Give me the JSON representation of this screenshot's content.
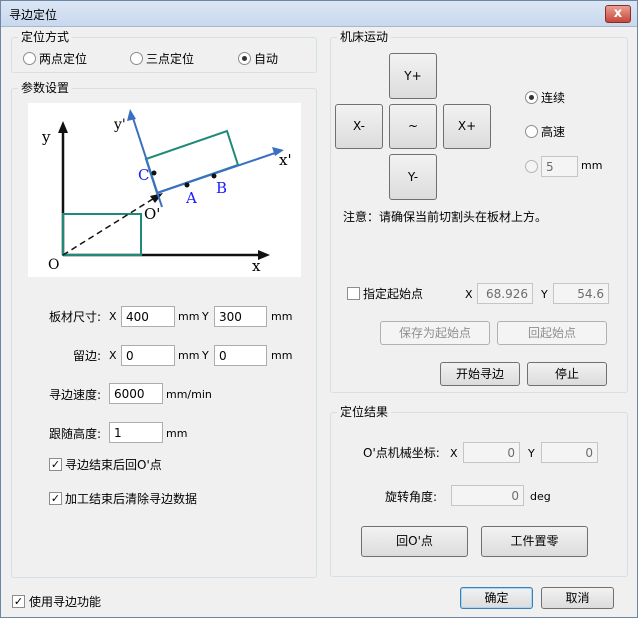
{
  "window": {
    "title": "寻边定位",
    "close": "x"
  },
  "positioning": {
    "title": "定位方式",
    "options": [
      "两点定位",
      "三点定位",
      "自动"
    ],
    "selected": 2
  },
  "params": {
    "title": "参数设置",
    "diagram": {
      "labels": {
        "y_prime": "y'",
        "y": "y",
        "x_prime": "x'",
        "c": "C",
        "a": "A",
        "b": "B",
        "o_prime": "O'",
        "o": "O",
        "x": "x"
      }
    },
    "sheet_size": {
      "label": "板材尺寸:",
      "x_label": "X",
      "x": "400",
      "unit1": "mm",
      "y_label": "Y",
      "y": "300",
      "unit2": "mm"
    },
    "margin": {
      "label": "留边:",
      "x_label": "X",
      "x": "0",
      "unit1": "mm",
      "y_label": "Y",
      "y": "0",
      "unit2": "mm"
    },
    "speed": {
      "label": "寻边速度:",
      "value": "6000",
      "unit": "mm/min"
    },
    "height": {
      "label": "跟随高度:",
      "value": "1",
      "unit": "mm"
    },
    "return_o": {
      "label": "寻边结束后回O'点",
      "checked": true
    },
    "clear_data": {
      "label": "加工结束后清除寻边数据",
      "checked": true
    }
  },
  "machine": {
    "title": "机床运动",
    "jog": {
      "yplus": "Y+",
      "xminus": "X-",
      "center": "~",
      "xplus": "X+",
      "yminus": "Y-"
    },
    "mode": {
      "options": [
        "连续",
        "高速"
      ],
      "selected": 0,
      "step_value": "5",
      "step_unit": "mm"
    },
    "note": "注意：请确保当前切割头在板材上方。",
    "start_point": {
      "label": "指定起始点",
      "checked": false,
      "x_label": "X",
      "x": "68.926",
      "y_label": "Y",
      "y": "54.6"
    },
    "save_start": "保存为起始点",
    "back_start": "回起始点",
    "start_edge": "开始寻边",
    "stop": "停止"
  },
  "result": {
    "title": "定位结果",
    "coord_label": "O'点机械坐标:",
    "x_label": "X",
    "x": "0",
    "y_label": "Y",
    "y": "0",
    "angle_label": "旋转角度:",
    "angle": "0",
    "angle_unit": "deg",
    "back_o": "回O'点",
    "workpiece_zero": "工件置零"
  },
  "footer": {
    "use_edge": "使用寻边功能",
    "use_edge_checked": true,
    "ok": "确定",
    "cancel": "取消"
  },
  "colors": {
    "diagram_teal": "#1f8a7a",
    "diagram_blue": "#3a6fc2",
    "label_blue": "#1a1aff"
  }
}
